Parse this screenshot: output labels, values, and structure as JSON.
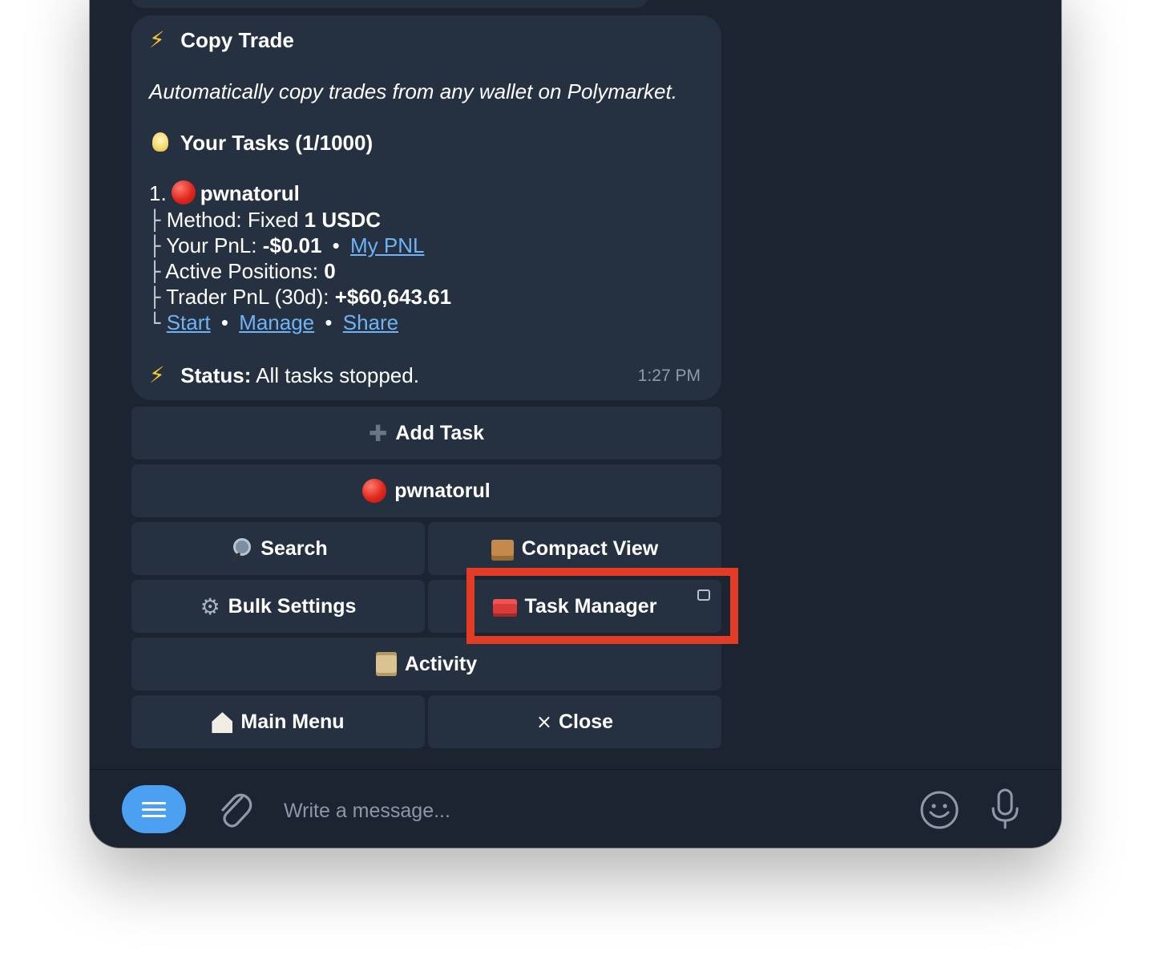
{
  "message": {
    "title": "Copy Trade",
    "description": "Automatically copy trades from any wallet on Polymarket.",
    "tasks_header": "Your Tasks (1/1000)",
    "task": {
      "index": "1.",
      "name": "pwnatorul",
      "method_label": "Method: Fixed ",
      "method_value": "1 USDC",
      "pnl_label": "Your PnL: ",
      "pnl_value": "-$0.01",
      "pnl_link": "My PNL",
      "positions_label": "Active Positions: ",
      "positions_value": "0",
      "trader_pnl_label": "Trader PnL (30d): ",
      "trader_pnl_value": "+$60,643.61",
      "links": {
        "start": "Start",
        "manage": "Manage",
        "share": "Share"
      }
    },
    "status_label": "Status:",
    "status_value": " All tasks stopped.",
    "time": "1:27 PM"
  },
  "tree_glyphs": {
    "branch": "├",
    "end": "└",
    "separator": "•"
  },
  "keyboard": {
    "add_task": "Add Task",
    "task_item": "pwnatorul",
    "search": "Search",
    "compact_view": "Compact View",
    "bulk_settings": "Bulk Settings",
    "task_manager": "Task Manager",
    "activity": "Activity",
    "main_menu": "Main Menu",
    "close": "Close",
    "close_glyph": "×"
  },
  "compose": {
    "placeholder": "Write a message..."
  },
  "icons": {
    "bolt": "lightning-icon",
    "bulb": "light-bulb-icon",
    "red_circle": "red-circle-icon",
    "plus": "plus-icon",
    "search": "magnifier-icon",
    "box": "package-icon",
    "gear": "gear-icon",
    "toolbox": "toolbox-icon",
    "scroll": "scroll-icon",
    "house": "house-icon",
    "menu": "menu-icon",
    "attach": "paperclip-icon",
    "emoji": "emoji-icon",
    "mic": "microphone-icon"
  },
  "colors": {
    "background": "#1c2432",
    "bubble": "#253041",
    "link": "#6fb3f5",
    "accent": "#4ba0f1",
    "highlight": "#e33b26"
  }
}
